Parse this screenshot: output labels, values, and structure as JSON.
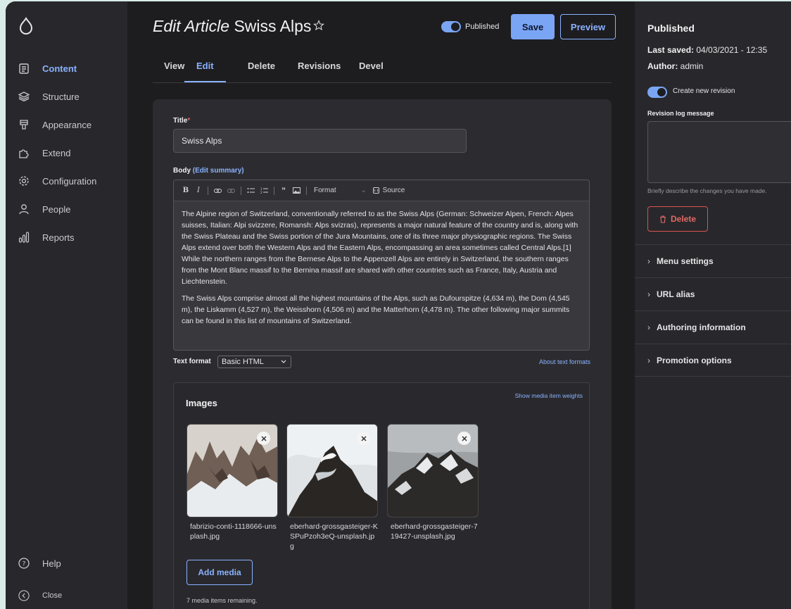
{
  "sidebar": {
    "items": [
      {
        "label": "Content",
        "icon": "document-icon",
        "active": true
      },
      {
        "label": "Structure",
        "icon": "layers-icon",
        "active": false
      },
      {
        "label": "Appearance",
        "icon": "paint-icon",
        "active": false
      },
      {
        "label": "Extend",
        "icon": "puzzle-icon",
        "active": false
      },
      {
        "label": "Configuration",
        "icon": "gear-icon",
        "active": false
      },
      {
        "label": "People",
        "icon": "person-icon",
        "active": false
      },
      {
        "label": "Reports",
        "icon": "bar-chart-icon",
        "active": false
      }
    ],
    "help": "Help",
    "close": "Close"
  },
  "header": {
    "title_prefix": "Edit Article",
    "title_name": "Swiss Alps",
    "published_label": "Published",
    "save_label": "Save",
    "preview_label": "Preview"
  },
  "tabs": [
    "View",
    "Edit",
    "Delete",
    "Revisions",
    "Devel"
  ],
  "form": {
    "title_label": "Title",
    "title_required": "*",
    "title_value": "Swiss Alps",
    "body_label": "Body",
    "body_link_open": "(",
    "body_link": "Edit summary",
    "body_link_close": ")",
    "toolbar_format": "Format",
    "toolbar_source": "Source",
    "body_paragraphs": [
      "The Alpine region of Switzerland, conventionally referred to as the Swiss Alps (German: Schweizer Alpen, French: Alpes suisses, Italian: Alpi svizzere, Romansh: Alps svizras), represents a major natural feature of the country and is, along with the Swiss Plateau and the Swiss portion of the Jura Mountains, one of its three major physiographic regions. The Swiss Alps extend over both the Western Alps and the Eastern Alps, encompassing an area sometimes called Central Alps.[1] While the northern ranges from the Bernese Alps to the Appenzell Alps are entirely in Switzerland, the southern ranges from the Mont Blanc massif to the Bernina massif are shared with other countries such as France, Italy, Austria and Liechtenstein.",
      "The Swiss Alps comprise almost all the highest mountains of the Alps, such as Dufourspitze (4,634 m), the Dom (4,545 m), the Liskamm (4,527 m), the Weisshorn (4,506 m) and the Matterhorn (4,478 m). The other following major summits can be found in this list of mountains of Switzerland."
    ],
    "text_format_label": "Text format",
    "text_format_value": "Basic HTML",
    "about_text_formats": "About text formats"
  },
  "media": {
    "title": "Images",
    "weights_link": "Show media item weights",
    "items": [
      {
        "filename": "fabrizio-conti-1118666-unsplash.jpg"
      },
      {
        "filename": "eberhard-grossgasteiger-KSPuPzoh3eQ-unsplash.jpg"
      },
      {
        "filename": "eberhard-grossgasteiger-719427-unsplash.jpg"
      }
    ],
    "add_label": "Add media",
    "remaining": "7 media items remaining."
  },
  "right_panel": {
    "status": "Published",
    "last_saved_label": "Last saved:",
    "last_saved_value": "04/03/2021 - 12:35",
    "author_label": "Author:",
    "author_value": "admin",
    "create_revision": "Create new revision",
    "revision_log_label": "Revision log message",
    "revision_log_hint": "Briefly describe the changes you have made.",
    "delete_label": "Delete",
    "accordions": [
      "Menu settings",
      "URL alias",
      "Authoring information",
      "Promotion options"
    ]
  },
  "colors": {
    "accent": "#8ab2ff",
    "danger": "#d9534f",
    "background": "#1d1d20"
  }
}
